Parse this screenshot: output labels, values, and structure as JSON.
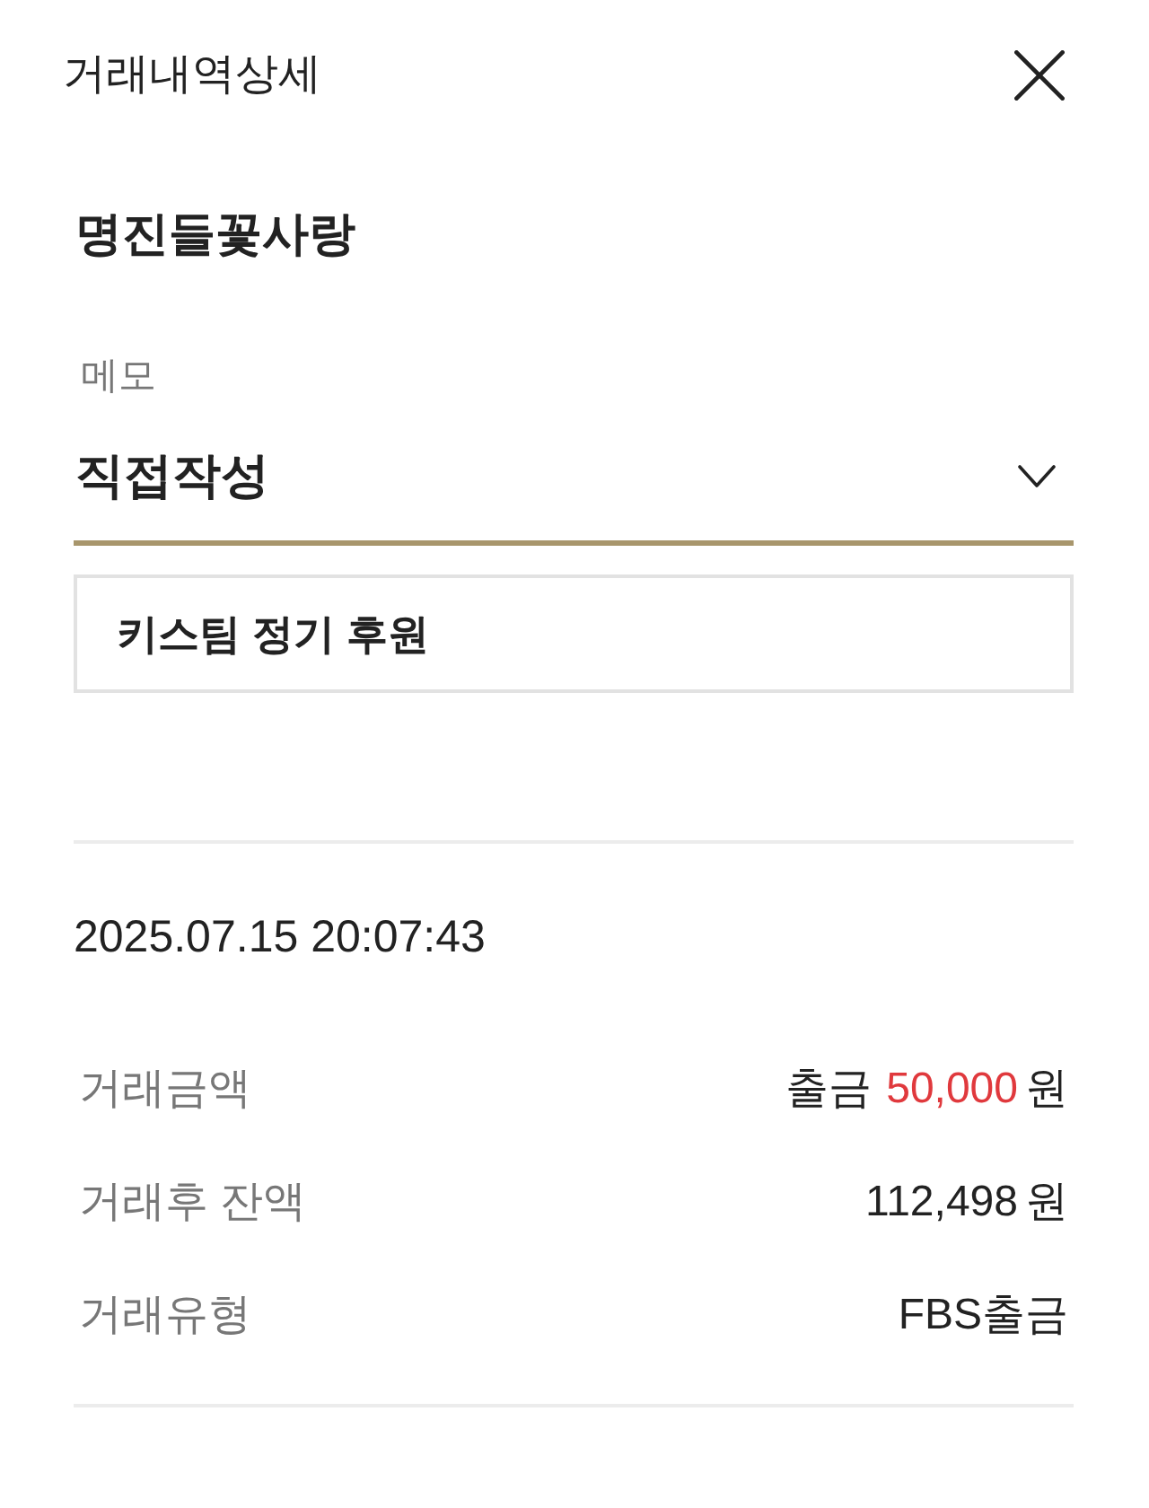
{
  "header": {
    "title": "거래내역상세"
  },
  "account_name": "명진들꽃사랑",
  "memo": {
    "label": "메모",
    "selected_option": "직접작성",
    "value": "키스팀 정기 후원"
  },
  "datetime": "2025.07.15 20:07:43",
  "details": [
    {
      "label": "거래금액",
      "kind": "withdrawal",
      "prefix": "출금",
      "amount": "50,000",
      "unit": "원"
    },
    {
      "label": "거래후 잔액",
      "kind": "amount",
      "amount": "112,498",
      "unit": "원"
    },
    {
      "label": "거래유형",
      "kind": "text",
      "value": "FBS출금"
    }
  ]
}
